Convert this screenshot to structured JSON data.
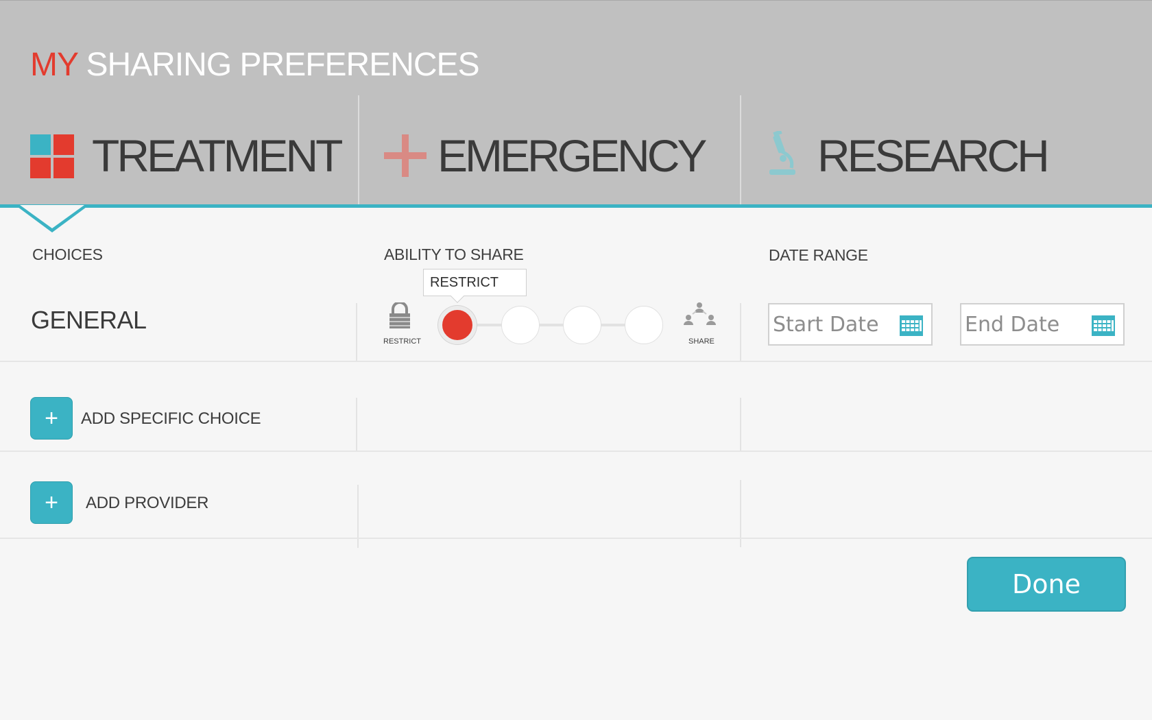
{
  "header": {
    "title_accent": "MY",
    "title_rest": "SHARING PREFERENCES",
    "tabs": [
      {
        "label": "TREATMENT",
        "icon": "grid-icon",
        "active": true
      },
      {
        "label": "EMERGENCY",
        "icon": "plus-icon",
        "active": false
      },
      {
        "label": "RESEARCH",
        "icon": "microscope-icon",
        "active": false
      }
    ]
  },
  "columns": {
    "choices": "CHOICES",
    "ability": "ABILITY TO SHARE",
    "date_range": "DATE RANGE"
  },
  "general_row": {
    "title": "GENERAL",
    "restrict_label": "RESTRICT",
    "share_label": "SHARE",
    "tooltip": "RESTRICT",
    "slider_stops": 4,
    "slider_selected_index": 0,
    "start_date_placeholder": "Start Date",
    "end_date_placeholder": "End Date"
  },
  "actions": {
    "add_specific_choice": "ADD SPECIFIC CHOICE",
    "add_provider": "ADD PROVIDER",
    "add_symbol": "+",
    "done": "Done"
  },
  "colors": {
    "accent_red": "#e33b2e",
    "accent_teal": "#3bb3c4",
    "header_gray": "#c0c0c0",
    "emergency_pink": "#d98a84",
    "research_teal": "#8cc9cf"
  }
}
